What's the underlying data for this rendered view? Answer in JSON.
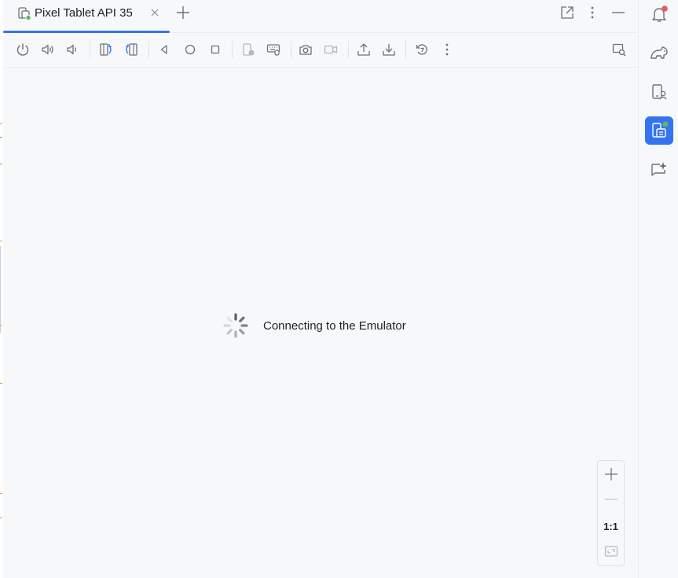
{
  "tab": {
    "title": "Pixel Tablet API 35"
  },
  "toolbar": {
    "buttons": [
      {
        "name": "power-icon"
      },
      {
        "name": "volume-up-icon"
      },
      {
        "name": "volume-down-icon"
      },
      {
        "name": "rotate-left-icon"
      },
      {
        "name": "rotate-right-icon"
      },
      {
        "name": "back-icon"
      },
      {
        "name": "home-icon"
      },
      {
        "name": "overview-icon"
      },
      {
        "name": "fold-device-icon"
      },
      {
        "name": "keyboard-icon"
      },
      {
        "name": "camera-icon"
      },
      {
        "name": "screen-record-icon"
      },
      {
        "name": "upload-icon"
      },
      {
        "name": "download-icon"
      },
      {
        "name": "snapshot-icon"
      },
      {
        "name": "more-options-icon"
      }
    ]
  },
  "status": {
    "message": "Connecting to the Emulator"
  },
  "zoom": {
    "actual_size_label": "1:1"
  },
  "colors": {
    "accent": "#3574f0",
    "notification_badge": "#e55c5c",
    "running_badge": "#5fb85f"
  }
}
